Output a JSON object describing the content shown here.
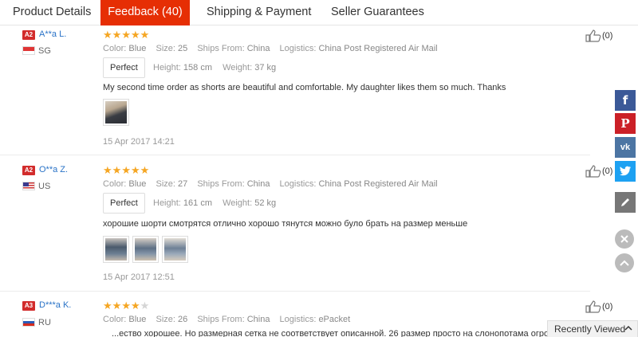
{
  "tabs": [
    {
      "label": "Product Details",
      "active": false
    },
    {
      "label": "Feedback (40)",
      "active": true
    },
    {
      "label": "Shipping & Payment",
      "active": false
    },
    {
      "label": "Seller Guarantees",
      "active": false
    }
  ],
  "labels": {
    "color": "Color:",
    "size": "Size:",
    "ships_from": "Ships From:",
    "logistics": "Logistics:",
    "height": "Height:",
    "weight": "Weight:"
  },
  "feedback": [
    {
      "level": "A2",
      "user": "A**a L.",
      "country": "SG",
      "stars": 5,
      "color": "Blue",
      "size": "25",
      "ships_from": "China",
      "logistics": "China Post Registered Air Mail",
      "fit": "Perfect",
      "height": "158 cm",
      "weight": "37 kg",
      "text": "My second time order as shorts are beautiful and comfortable. My daughter likes them so much. Thanks",
      "photo_count": 1,
      "date": "15 Apr 2017 14:21",
      "helpful": "(0)"
    },
    {
      "level": "A2",
      "user": "O**a Z.",
      "country": "US",
      "stars": 5,
      "color": "Blue",
      "size": "27",
      "ships_from": "China",
      "logistics": "China Post Registered Air Mail",
      "fit": "Perfect",
      "height": "161 cm",
      "weight": "52 kg",
      "text": "хорошие шорти смотрятся отлично хорошо тянутся можно було брать на размер меньше",
      "photo_count": 3,
      "date": "15 Apr 2017 12:51",
      "helpful": "(0)"
    },
    {
      "level": "A3",
      "user": "D***a K.",
      "country": "RU",
      "stars": 4,
      "color": "Blue",
      "size": "26",
      "ships_from": "China",
      "logistics": "ePacket",
      "text": "...ество хорошее. Но размерная сетка не соответствует описанной. 26 размер просто на слонопотама огро...",
      "helpful": "(0)"
    }
  ],
  "share": [
    "facebook-icon",
    "pinterest-icon",
    "vk-icon",
    "twitter-icon",
    "edit-icon"
  ],
  "recently_viewed": "Recently Viewed",
  "colors": {
    "accent": "#e62e04",
    "star": "#f5a623",
    "user_link": "#2a73c7",
    "level_badge": "#d22c2c"
  }
}
